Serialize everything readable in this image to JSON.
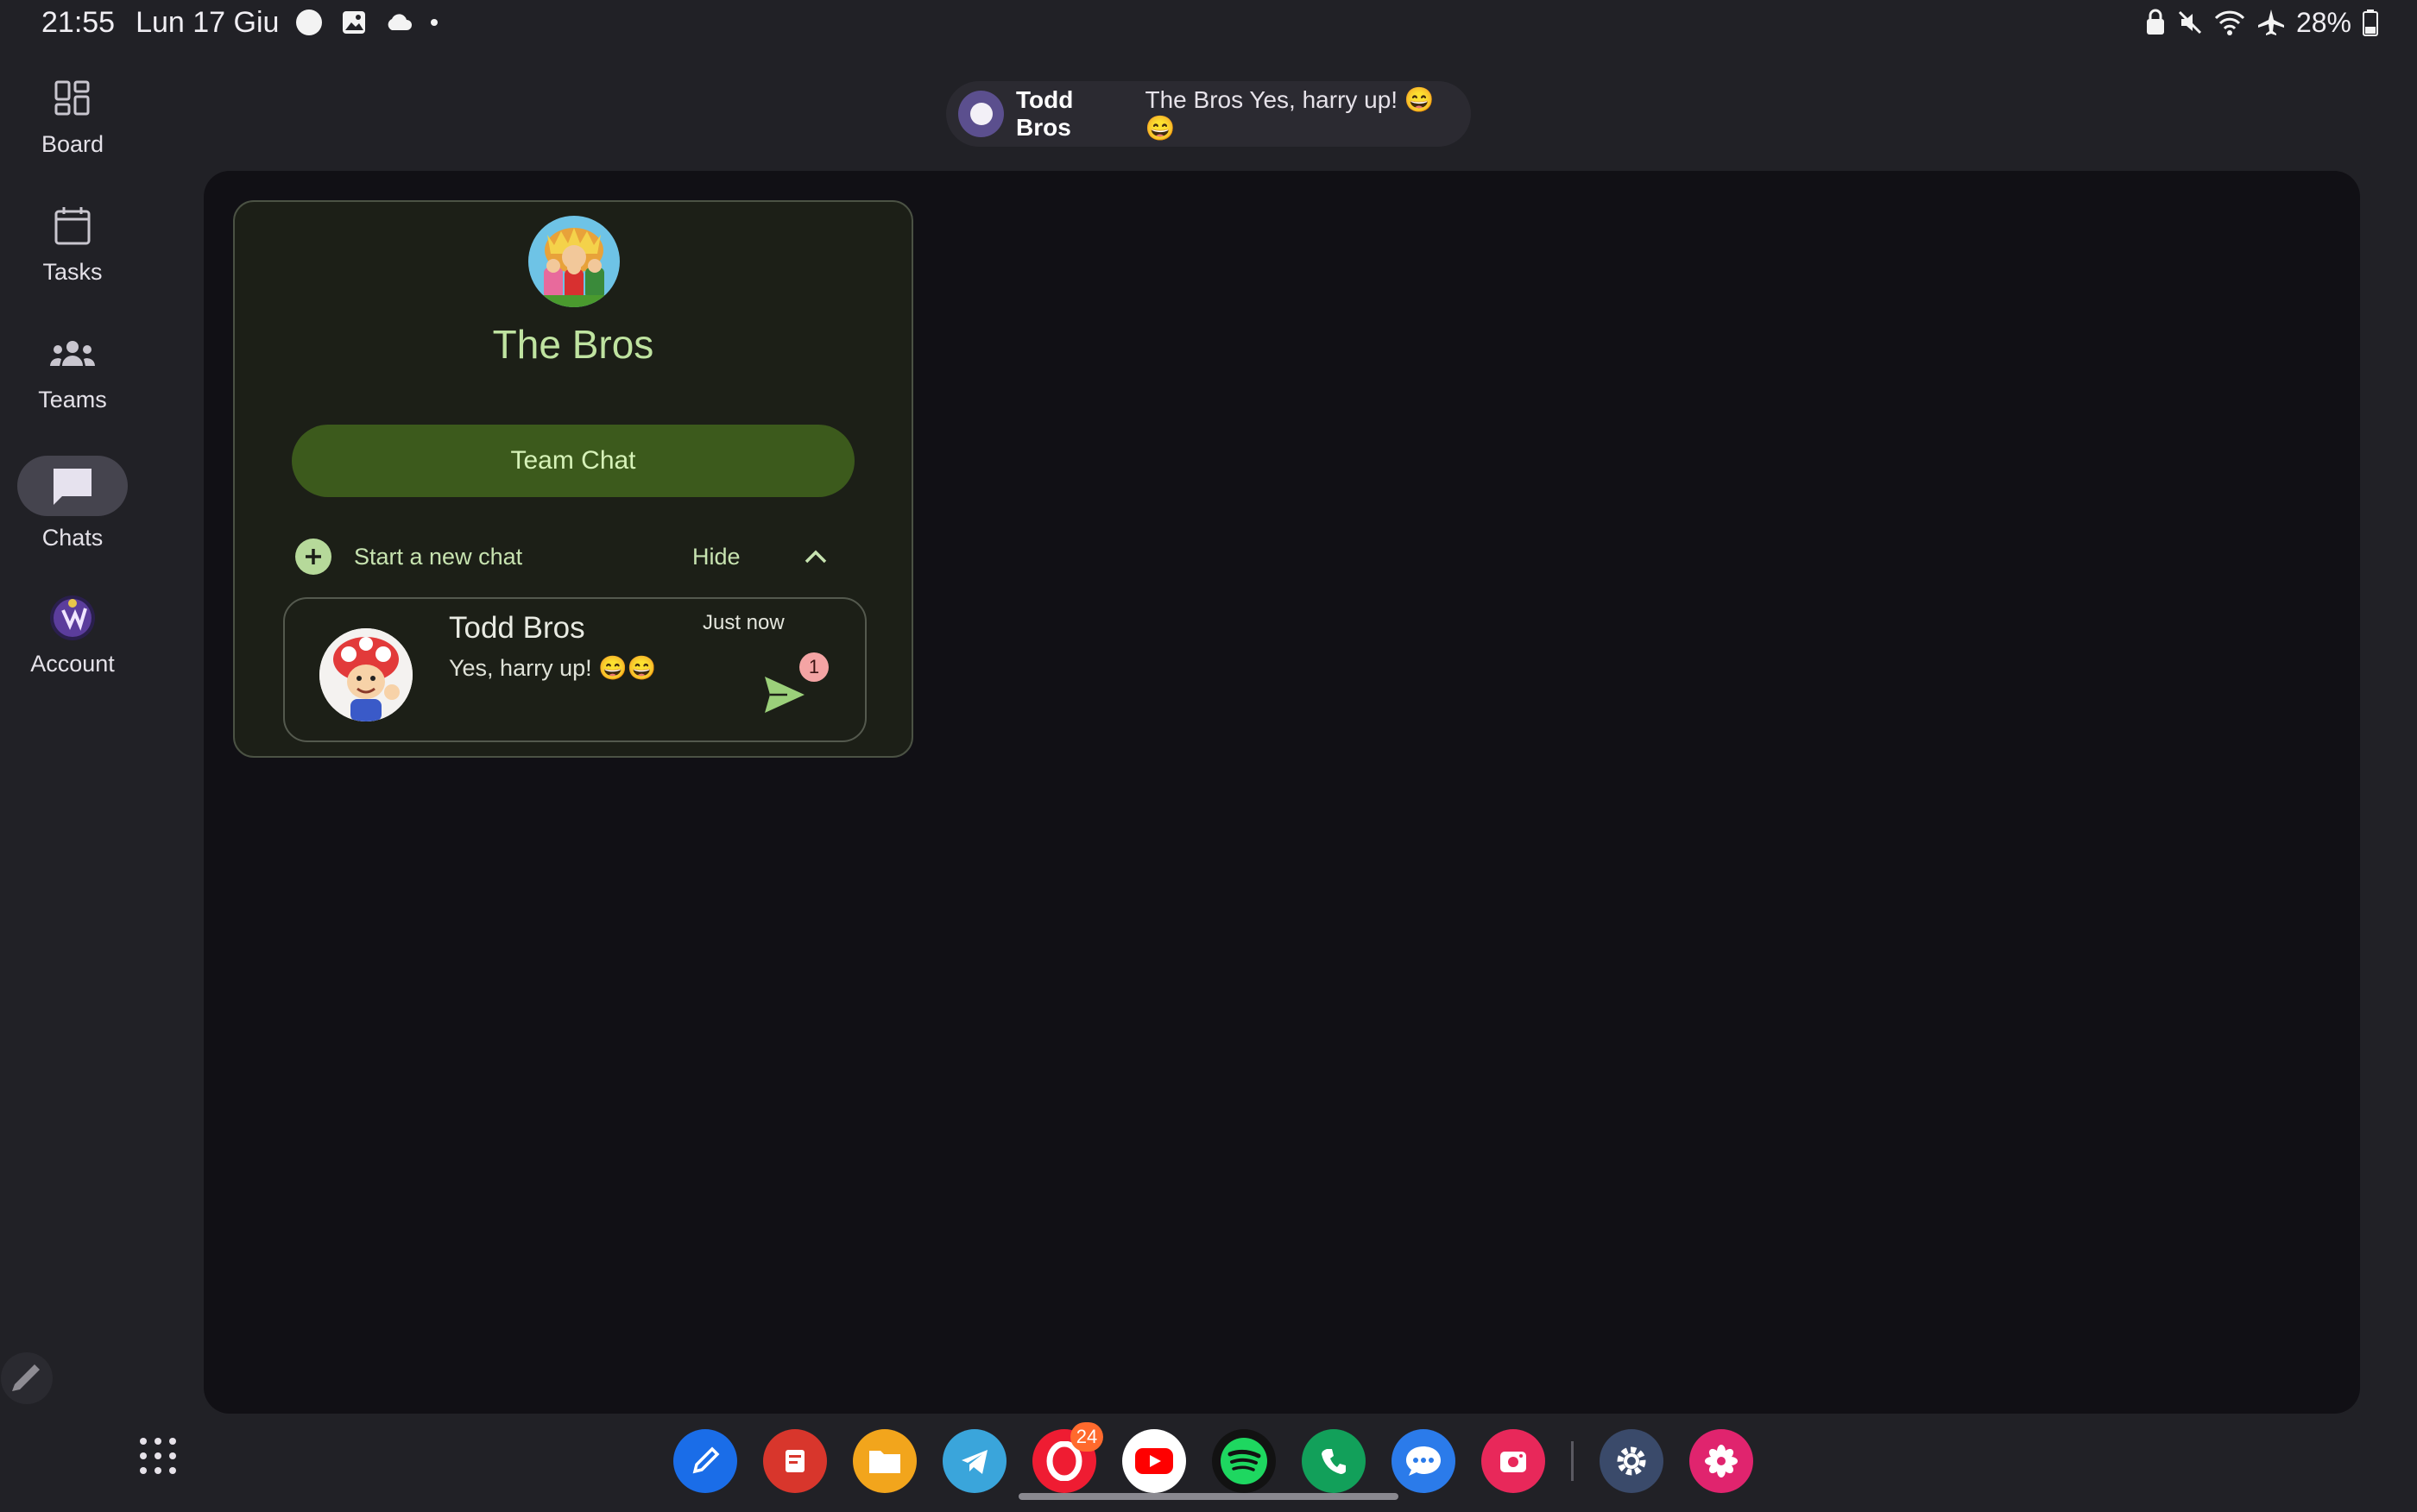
{
  "status_bar": {
    "time": "21:55",
    "date": "Lun 17 Giu",
    "battery": "28%",
    "icons": [
      "circle-icon",
      "image-icon",
      "cloud-icon",
      "dot-icon",
      "lock-icon",
      "mute-icon",
      "wifi-icon",
      "airplane-icon",
      "battery-icon"
    ]
  },
  "nav": {
    "items": [
      {
        "label": "Board",
        "icon": "board-icon"
      },
      {
        "label": "Tasks",
        "icon": "calendar-icon"
      },
      {
        "label": "Teams",
        "icon": "teams-icon"
      },
      {
        "label": "Chats",
        "icon": "chat-icon",
        "selected": true
      },
      {
        "label": "Account",
        "icon": "account-avatar-icon"
      }
    ]
  },
  "notification": {
    "sender": "Todd Bros",
    "text": "The Bros Yes, harry up! 😄😄"
  },
  "team": {
    "name": "The Bros",
    "team_chat_label": "Team Chat",
    "start_chat_label": "Start a new chat",
    "hide_label": "Hide"
  },
  "chats": [
    {
      "name": "Todd Bros",
      "message": "Yes, harry up! 😄😄",
      "time": "Just now",
      "unread": "1"
    }
  ],
  "dock": {
    "apps": [
      "pen-app-icon",
      "notes-app-icon",
      "files-app-icon",
      "telegram-app-icon",
      "opera-app-icon",
      "youtube-app-icon",
      "spotify-app-icon",
      "phone-app-icon",
      "messages-app-icon",
      "screen-recorder-app-icon",
      "settings-app-icon",
      "blossom-app-icon"
    ],
    "opera_badge": "24"
  },
  "colors": {
    "background": "#212126",
    "panel": "#111015",
    "accent_green": "#3c5a1c",
    "title_green": "#bfe3a0"
  }
}
